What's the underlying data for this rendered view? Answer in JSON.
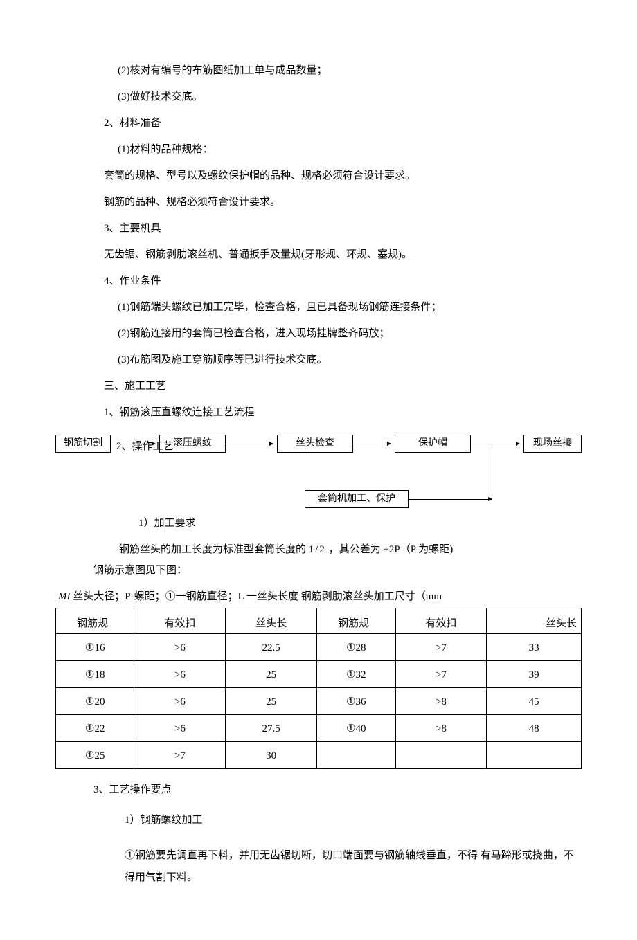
{
  "lines": {
    "l1": "(2)核对有编号的布筋图纸加工单与成品数量；",
    "l2": "(3)做好技术交底。",
    "l3": "2、材料准备",
    "l4": "(1)材料的品种规格：",
    "l5": "套筒的规格、型号以及螺纹保护帽的品种、规格必须符合设计要求。",
    "l6": "钢筋的品种、规格必须符合设计要求。",
    "l7": "3、主要机具",
    "l8": "无齿锯、钢筋剥肋滚丝机、普通扳手及量规(牙形规、环规、塞规)。",
    "l9": "4、作业条件",
    "l10": "(1)钢筋端头螺纹已加工完毕，检查合格，且已具备现场钢筋连接条件；",
    "l11": "(2)钢筋连接用的套筒已检查合格，进入现场挂牌整齐码放；",
    "l12": "(3)布筋图及施工穿筋顺序等已进行技术交底。",
    "l13": "三、施工工艺",
    "l14": "1、钢筋滚压直螺纹连接工艺流程",
    "l15a": "2、操作工艺",
    "l16": "1）加工要求",
    "l17a": "钢筋丝头的加工长度为标准型套筒长度的",
    "l17b": "1/2",
    "l17c": "，其公差为",
    "l17d": "+2P（P 为螺距)",
    "l18": "钢筋示意图见下图：",
    "l19": "3、工艺操作要点",
    "l20": "1）钢筋螺纹加工",
    "l21": "①钢筋要先调直再下料，并用无齿锯切断，切口端面要与钢筋轴线垂直，不得 有马蹄形或挠曲，不得用气割下料。"
  },
  "flow": {
    "b1": "钢筋切割",
    "b2": "滚压螺纹",
    "b3": "丝头检查",
    "b4": "保护帽",
    "b5": "现场丝接",
    "b6": "套筒机加工、保护"
  },
  "tableCaption": {
    "ital": "MI ",
    "rest": "丝头大径；P-螺距；①一钢筋直径；L 一丝头长度  钢筋剥肋滚丝头加工尺寸（mm"
  },
  "headers": [
    "钢筋规",
    "有效扣",
    "丝头长",
    "钢筋规",
    "有效扣",
    "丝头长"
  ],
  "rows": [
    [
      "①16",
      ">6",
      "22.5",
      "①28",
      ">7",
      "33"
    ],
    [
      "①18",
      ">6",
      "25",
      "①32",
      ">7",
      "39"
    ],
    [
      "①20",
      ">6",
      "25",
      "①36",
      ">8",
      "45"
    ],
    [
      "①22",
      ">6",
      "27.5",
      "①40",
      ">8",
      "48"
    ],
    [
      "①25",
      ">7",
      "30",
      "",
      "",
      ""
    ]
  ]
}
